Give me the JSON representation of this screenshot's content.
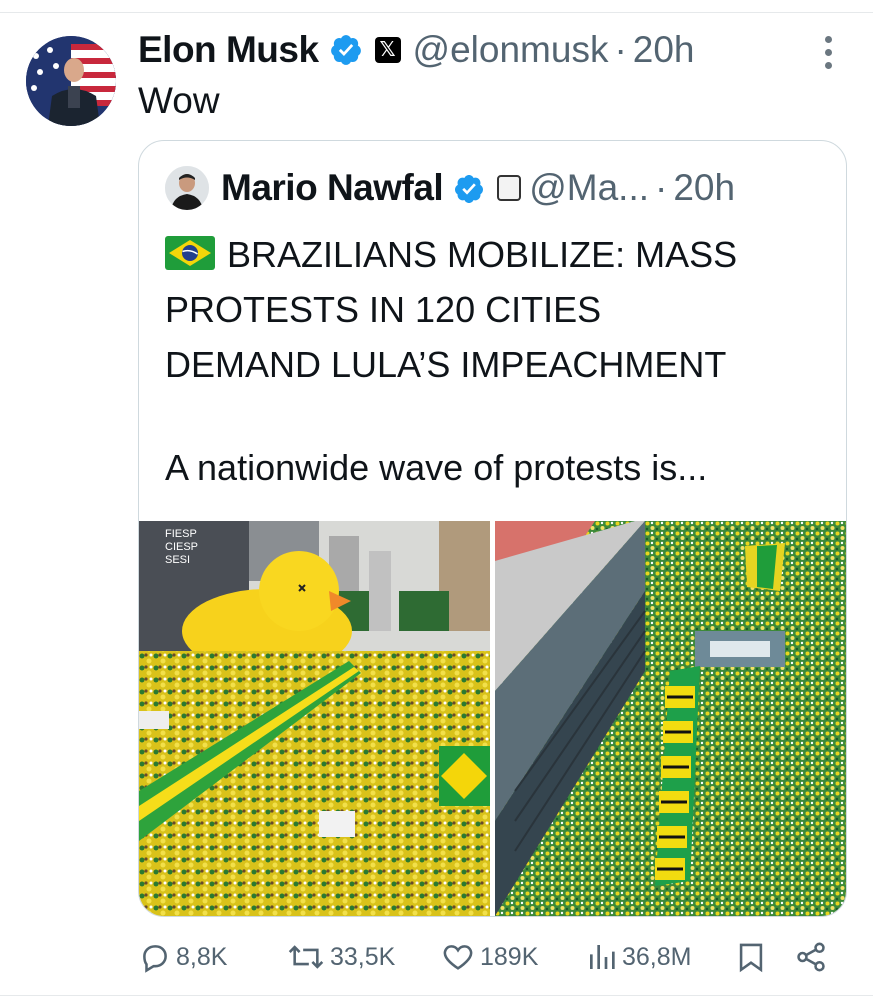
{
  "tweet": {
    "author_name": "Elon Musk",
    "handle": "@elonmusk",
    "separator": "·",
    "time": "20h",
    "text": "Wow",
    "x_badge": "𝕏"
  },
  "quote": {
    "author_name": "Mario Nawfal",
    "handle": "@Ma...",
    "separator": "·",
    "time": "20h",
    "headline_line1": "BRAZILIANS MOBILIZE: MASS",
    "headline_line2": "PROTESTS IN 120 CITIES",
    "headline_line3": "DEMAND LULA’S IMPEACHMENT",
    "summary": "A nationwide wave of protests is...",
    "image1_sign": [
      "FIESP",
      "CIESP",
      "SESI"
    ]
  },
  "actions": {
    "replies": "8,8K",
    "reposts": "33,5K",
    "likes": "189K",
    "views": "36,8M"
  },
  "icons": {
    "verified": "verified-check-icon",
    "reply": "reply-bubble-icon",
    "repost": "repost-arrows-icon",
    "like": "heart-icon",
    "views": "bar-chart-icon",
    "bookmark": "bookmark-icon",
    "share": "share-icon",
    "more": "more-vertical-icon"
  },
  "colors": {
    "verified_blue": "#1d9bf0",
    "secondary_text": "#536471",
    "brazil_green": "#1f9d3a",
    "brazil_yellow": "#f4d60a"
  }
}
